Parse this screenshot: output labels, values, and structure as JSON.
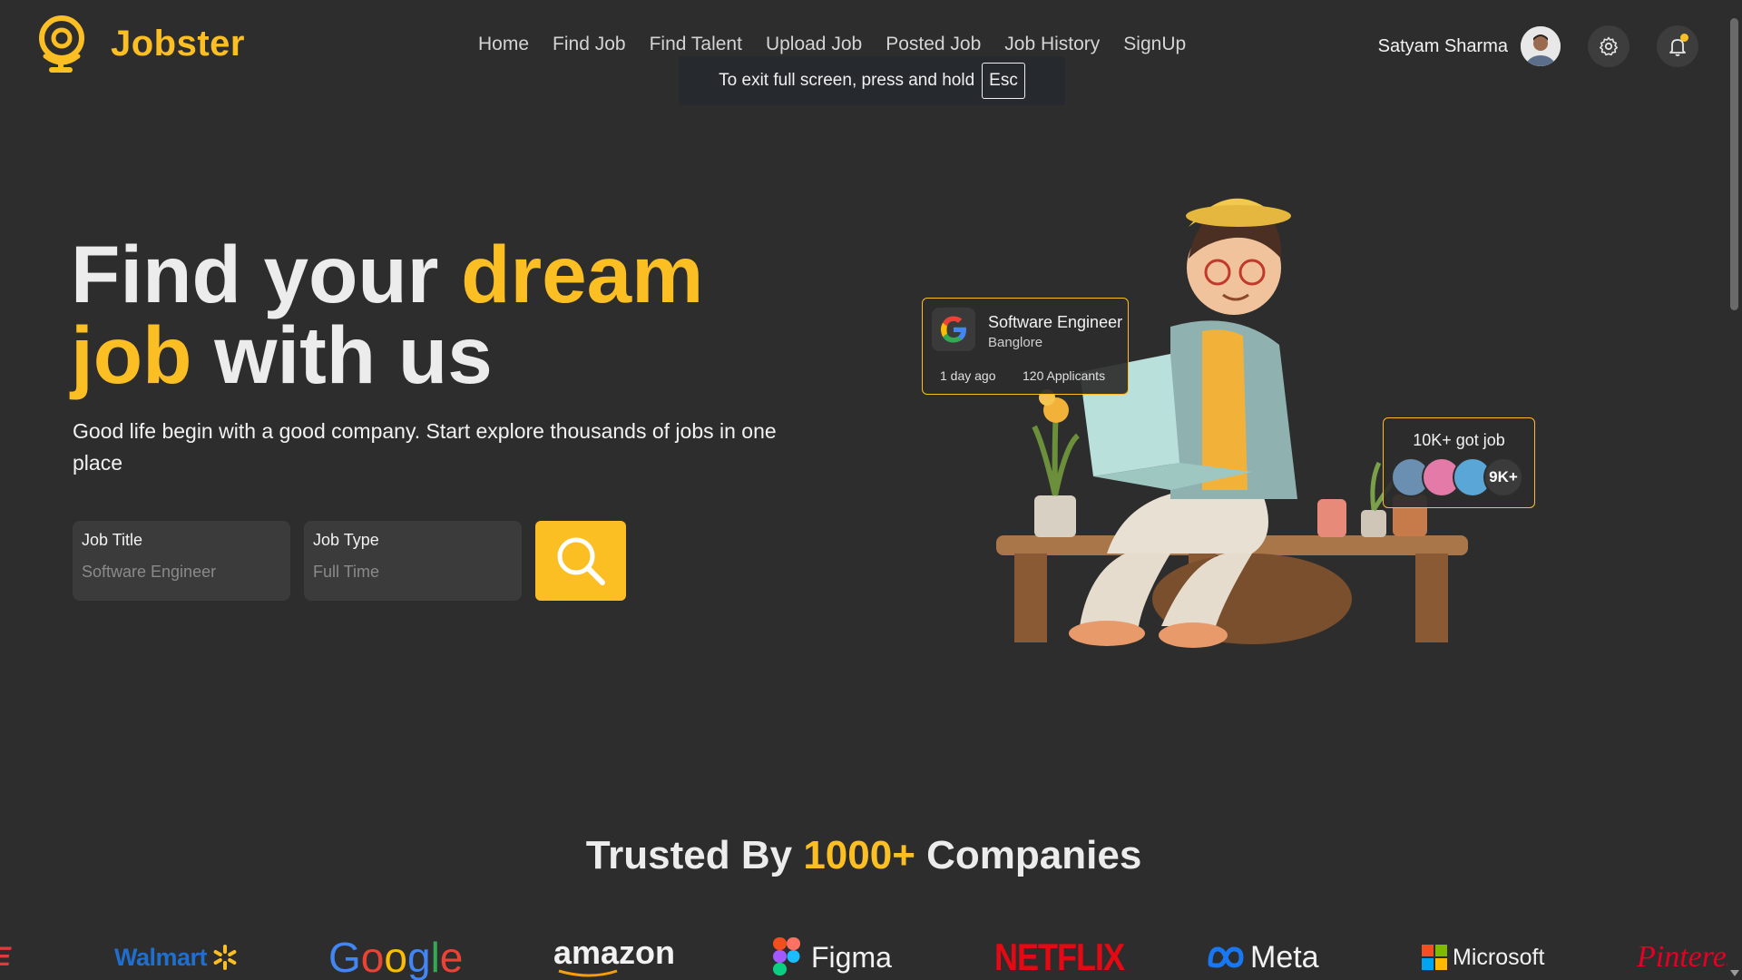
{
  "header": {
    "brand": "Jobster",
    "nav": [
      "Home",
      "Find Job",
      "Find Talent",
      "Upload Job",
      "Posted Job",
      "Job History",
      "SignUp"
    ],
    "user_name": "Satyam Sharma",
    "fullscreen_hint": "To exit full screen, press and hold",
    "fullscreen_key": "Esc"
  },
  "hero": {
    "title_part1": "Find your ",
    "title_highlight1": "dream",
    "title_highlight2": "job",
    "title_part2": " with us",
    "subtitle": "Good life begin with a good company. Start explore thousands of jobs in one place",
    "fields": {
      "job_title_label": "Job Title",
      "job_title_placeholder": "Software Engineer",
      "job_type_label": "Job Type",
      "job_type_placeholder": "Full Time"
    }
  },
  "job_card": {
    "title": "Software Engineer",
    "location": "Banglore",
    "posted": "1 day ago",
    "applicants": "120 Applicants"
  },
  "got_job_card": {
    "title": "10K+ got job",
    "count": "9K+"
  },
  "trusted": {
    "prefix": "Trusted By ",
    "highlight": "1000+",
    "suffix": " Companies"
  },
  "companies": [
    "Walmart",
    "Google",
    "amazon",
    "Figma",
    "NETFLIX",
    "Meta",
    "Microsoft",
    "Pinterest"
  ],
  "colors": {
    "accent": "#fbbf24",
    "background": "#2d2d2d",
    "card": "#3b3b3b"
  }
}
